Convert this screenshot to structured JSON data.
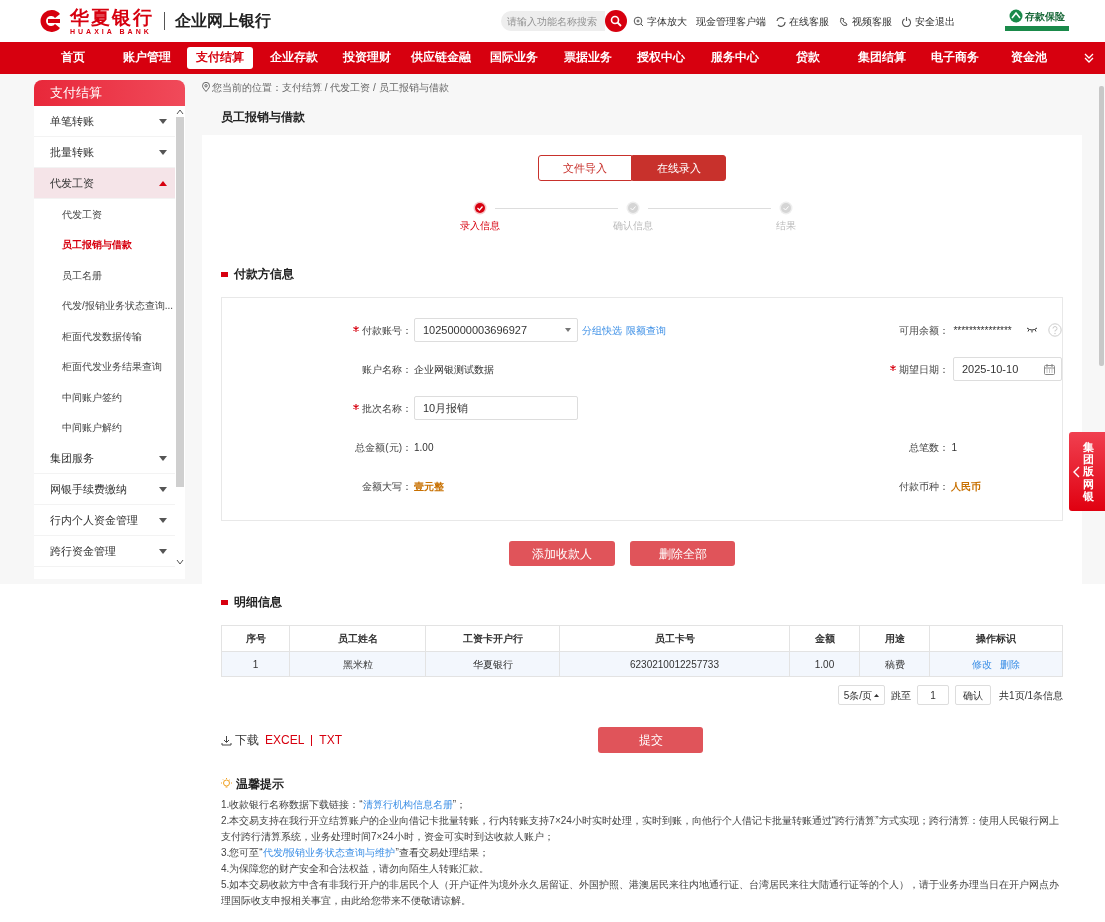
{
  "header": {
    "logo_cn": "华夏银行",
    "logo_en": "HUAXIA BANK",
    "site_title": "企业网上银行",
    "search": {
      "placeholder": "请输入功能名称搜索"
    },
    "links": [
      {
        "label": "字体放大",
        "kind": "zoom"
      },
      {
        "label": "现金管理客户端",
        "kind": "plain"
      },
      {
        "label": "在线客服",
        "kind": "chat"
      },
      {
        "label": "视频客服",
        "kind": "video"
      },
      {
        "label": "安全退出",
        "kind": "power"
      }
    ],
    "badge": "存款保险"
  },
  "nav": [
    {
      "label": "首页",
      "selected": false
    },
    {
      "label": "账户管理",
      "selected": false
    },
    {
      "label": "支付结算",
      "selected": true
    },
    {
      "label": "企业存款",
      "selected": false
    },
    {
      "label": "投资理财",
      "selected": false
    },
    {
      "label": "供应链金融",
      "selected": false
    },
    {
      "label": "国际业务",
      "selected": false
    },
    {
      "label": "票据业务",
      "selected": false
    },
    {
      "label": "授权中心",
      "selected": false
    },
    {
      "label": "服务中心",
      "selected": false
    },
    {
      "label": "贷款",
      "selected": false
    },
    {
      "label": "集团结算",
      "selected": false
    },
    {
      "label": "电子商务",
      "selected": false
    },
    {
      "label": "资金池",
      "selected": false
    }
  ],
  "sidebar": {
    "title": "支付结算",
    "items": [
      {
        "label": "单笔转账",
        "expanded": false,
        "selected": false
      },
      {
        "label": "批量转账",
        "expanded": false,
        "selected": false
      },
      {
        "label": "代发工资",
        "expanded": true,
        "selected": true,
        "children": [
          {
            "label": "代发工资",
            "selected": false
          },
          {
            "label": "员工报销与借款",
            "selected": true
          },
          {
            "label": "员工名册",
            "selected": false
          },
          {
            "label": "代发/报销业务状态查询...",
            "selected": false
          },
          {
            "label": "柜面代发数据传输",
            "selected": false
          },
          {
            "label": "柜面代发业务结果查询",
            "selected": false
          },
          {
            "label": "中间账户签约",
            "selected": false
          },
          {
            "label": "中间账户解约",
            "selected": false
          }
        ]
      },
      {
        "label": "集团服务",
        "expanded": false,
        "selected": false
      },
      {
        "label": "网银手续费缴纳",
        "expanded": false,
        "selected": false
      },
      {
        "label": "行内个人资金管理",
        "expanded": false,
        "selected": false
      },
      {
        "label": "跨行资金管理",
        "expanded": false,
        "selected": false
      }
    ]
  },
  "breadcrumb": "您当前的位置：支付结算 / 代发工资 / 员工报销与借款",
  "page_title": "员工报销与借款",
  "mode_tabs": [
    {
      "label": "文件导入",
      "selected": false
    },
    {
      "label": "在线录入",
      "selected": true
    }
  ],
  "steps": [
    {
      "label": "录入信息",
      "done": true
    },
    {
      "label": "确认信息",
      "done": false
    },
    {
      "label": "结果",
      "done": false
    }
  ],
  "payer": {
    "title": "付款方信息",
    "rows": [
      {
        "cells": [
          {
            "kind": "select",
            "label": "付款账号：",
            "required": true,
            "value": "10250000003696927",
            "links": [
              "分组快选",
              "限额查询"
            ]
          },
          {
            "kind": "masked",
            "label": "可用余额：",
            "required": false,
            "value": "***************"
          }
        ]
      },
      {
        "cells": [
          {
            "kind": "text",
            "label": "账户名称：",
            "required": false,
            "value": "企业网银测试数据"
          },
          {
            "kind": "date",
            "label": "期望日期：",
            "required": true,
            "value": "2025-10-10"
          }
        ]
      },
      {
        "cells": [
          {
            "kind": "input",
            "label": "批次名称：",
            "required": true,
            "value": "10月报销"
          }
        ]
      },
      {
        "cells": [
          {
            "kind": "text",
            "label": "总金额(元)：",
            "required": false,
            "value": "1.00"
          },
          {
            "kind": "text",
            "label": "总笔数：",
            "required": false,
            "value": "1"
          }
        ]
      },
      {
        "cells": [
          {
            "kind": "highlight",
            "label": "金额大写：",
            "required": false,
            "value": "壹元整"
          },
          {
            "kind": "highlight",
            "label": "付款币种：",
            "required": false,
            "value": "人民币"
          }
        ]
      }
    ]
  },
  "actions": [
    "添加收款人",
    "删除全部"
  ],
  "detail": {
    "title": "明细信息",
    "columns": [
      "序号",
      "员工姓名",
      "工资卡开户行",
      "员工卡号",
      "金额",
      "用途",
      "操作标识"
    ],
    "rows": [
      {
        "cells": [
          "1",
          "黑米粒",
          "华夏银行",
          "6230210012257733",
          "1.00",
          "稿费"
        ],
        "actions": [
          "修改",
          "删除"
        ]
      }
    ]
  },
  "pagination": {
    "page_size": "5条/页",
    "jump_label": "跳至",
    "page": "1",
    "confirm": "确认",
    "summary": "共1页/1条信息"
  },
  "download": {
    "label": "下载",
    "formats": [
      "EXCEL",
      "TXT"
    ]
  },
  "submit": "提交",
  "tips": {
    "title": "温馨提示",
    "items": [
      {
        "parts": [
          {
            "text": "1.收款银行名称数据下载链接：“"
          },
          {
            "text": "清算行机构信息名册",
            "link": true
          },
          {
            "text": "”；"
          }
        ]
      },
      {
        "parts": [
          {
            "text": "2.本交易支持在我行开立结算账户的企业向借记卡批量转账，行内转账支持7×24小时实时处理，实时到账，向他行个人借记卡批量转账通过“跨行清算”方式实现；跨行清算：使用人民银行网上支付跨行清算系统，业务处理时间7×24小时，资金可实时到达收款人账户；"
          }
        ]
      },
      {
        "parts": [
          {
            "text": "3.您可至“"
          },
          {
            "text": "代发/报销业务状态查询与维护",
            "link": true
          },
          {
            "text": "”查看交易处理结果；"
          }
        ]
      },
      {
        "parts": [
          {
            "text": "4.为保障您的财产安全和合法权益，请勿向陌生人转账汇款。"
          }
        ]
      },
      {
        "parts": [
          {
            "text": "5.如本交易收款方中含有非我行开户的非居民个人（开户证件为境外永久居留证、外国护照、港澳居民来往内地通行证、台湾居民来往大陆通行证等的个人），请于业务办理当日在开户网点办理国际收支申报相关事宜，由此给您带来不便敬请谅解。"
          }
        ]
      }
    ]
  },
  "side_tab": "集团版网银"
}
